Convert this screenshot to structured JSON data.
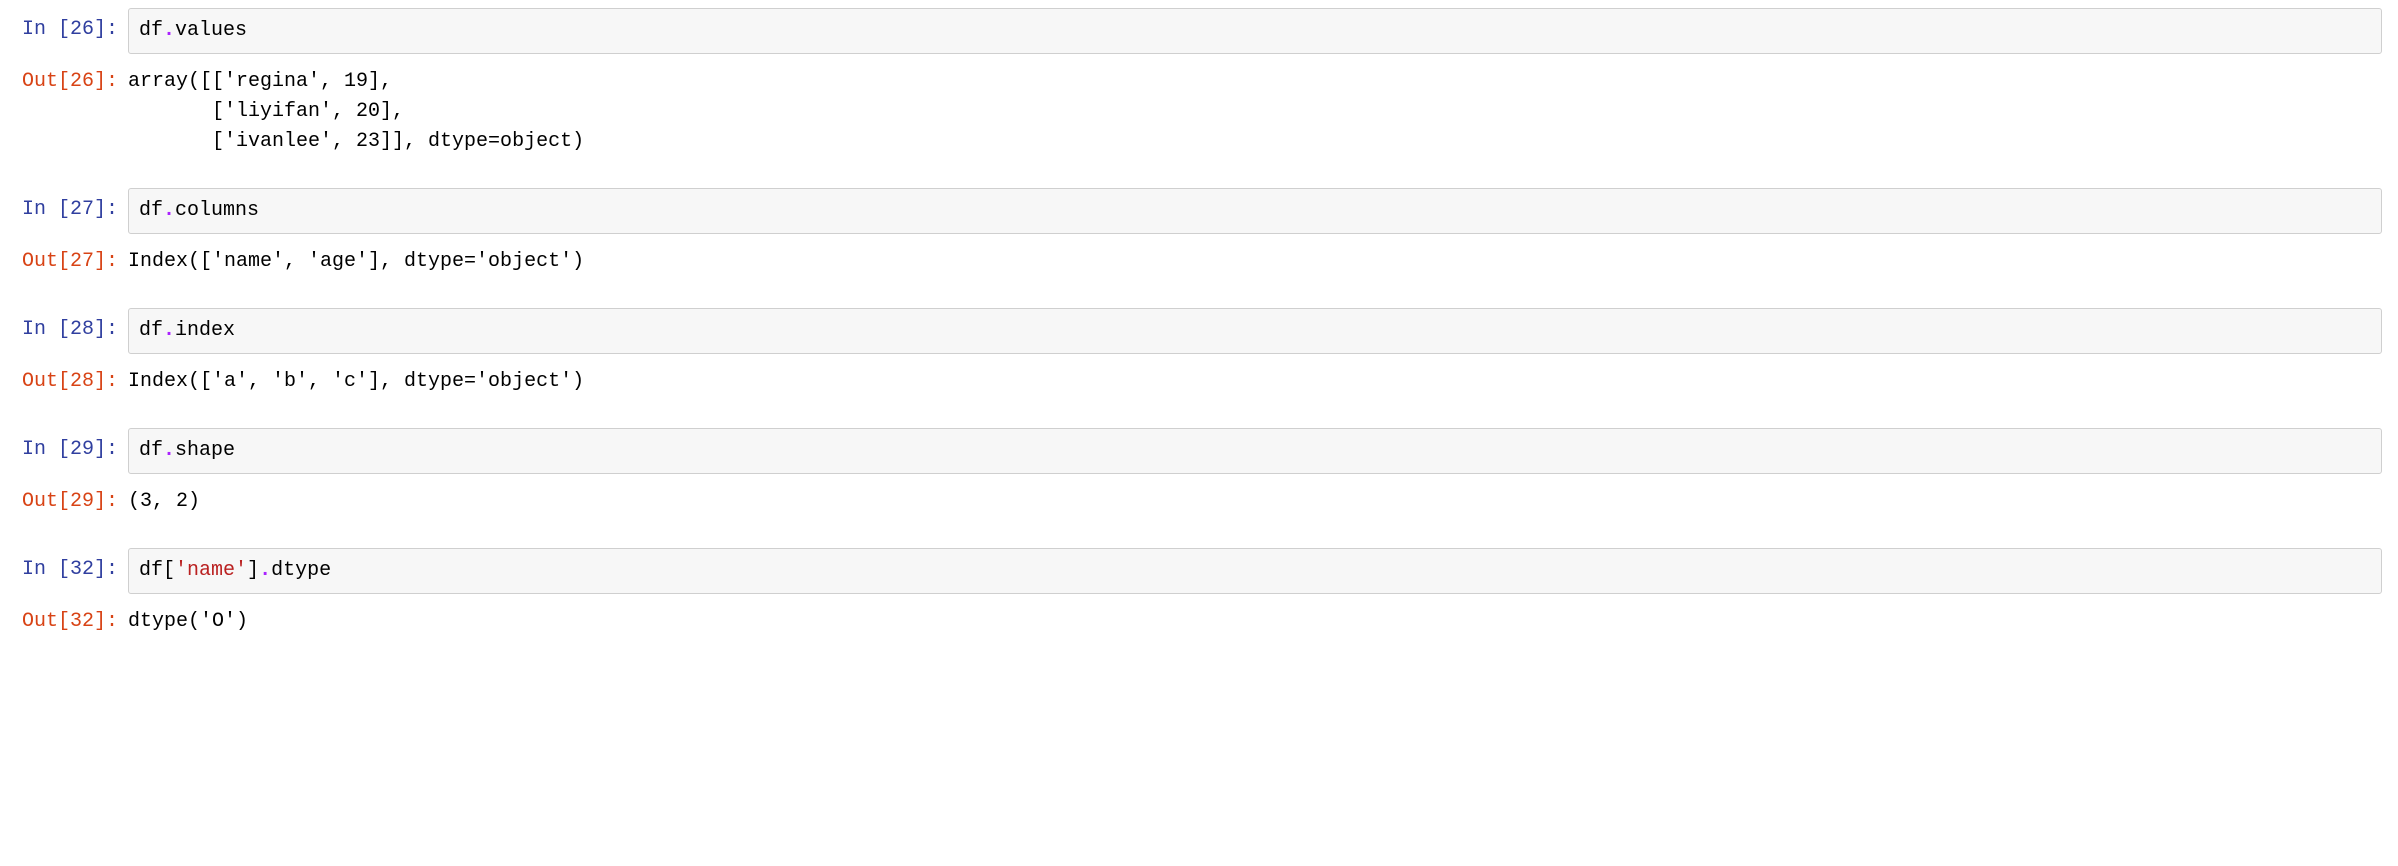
{
  "cells": [
    {
      "in_prompt": "In [26]:",
      "out_prompt": "Out[26]:",
      "code": {
        "ident1": "df",
        "op": ".",
        "attr": "values"
      },
      "output": "array([['regina', 19],\n       ['liyifan', 20],\n       ['ivanlee', 23]], dtype=object)"
    },
    {
      "in_prompt": "In [27]:",
      "out_prompt": "Out[27]:",
      "code": {
        "ident1": "df",
        "op": ".",
        "attr": "columns"
      },
      "output": "Index(['name', 'age'], dtype='object')"
    },
    {
      "in_prompt": "In [28]:",
      "out_prompt": "Out[28]:",
      "code": {
        "ident1": "df",
        "op": ".",
        "attr": "index"
      },
      "output": "Index(['a', 'b', 'c'], dtype='object')"
    },
    {
      "in_prompt": "In [29]:",
      "out_prompt": "Out[29]:",
      "code": {
        "ident1": "df",
        "op": ".",
        "attr": "shape"
      },
      "output": "(3, 2)"
    },
    {
      "in_prompt": "In [32]:",
      "out_prompt": "Out[32]:",
      "code_indexed": {
        "ident1": "df",
        "lbracket": "[",
        "str": "'name'",
        "rbracket": "]",
        "op": ".",
        "attr": "dtype"
      },
      "output": "dtype('O')"
    }
  ]
}
